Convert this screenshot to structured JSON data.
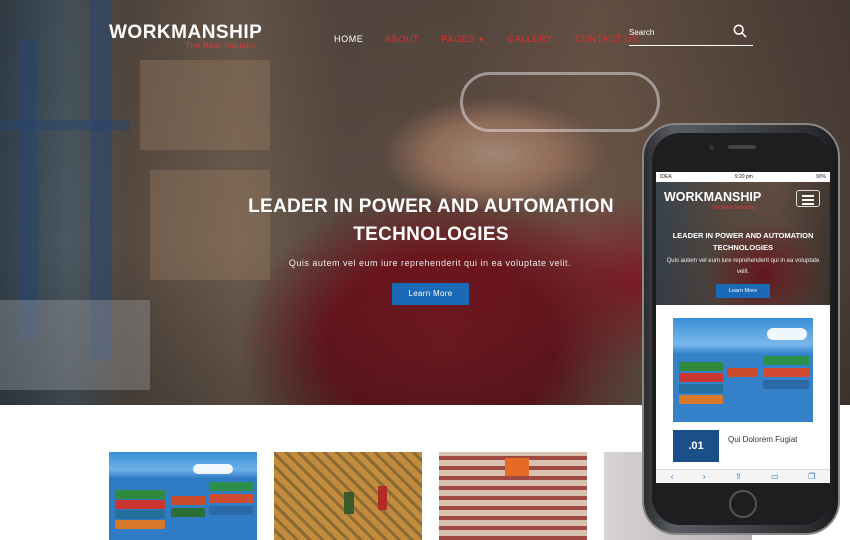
{
  "brand": {
    "name": "WORKMANSHIP",
    "tagline": "The Real Industry"
  },
  "nav": {
    "items": [
      {
        "label": "HOME",
        "active": true
      },
      {
        "label": "ABOUT",
        "active": false
      },
      {
        "label": "PAGES",
        "active": false,
        "has_dropdown": true
      },
      {
        "label": "GALLERY",
        "active": false
      },
      {
        "label": "CONTACT US",
        "active": false
      }
    ]
  },
  "search": {
    "placeholder": "Search",
    "icon": "search-icon"
  },
  "hero": {
    "headline_line1": "LEADER IN POWER AND AUTOMATION",
    "headline_line2": "TECHNOLOGIES",
    "subtext": "Quis autem vel eum iure reprehenderit qui in ea voluptate velit.",
    "button_label": "Learn More"
  },
  "colors": {
    "accent_red": "#e02f2f",
    "button_blue": "#1a6ab8",
    "badge_navy": "#1a4f89"
  },
  "mobile": {
    "status": {
      "carrier": "IDEA",
      "time": "9:20 pm",
      "battery": "90%"
    },
    "brand": {
      "name": "WORKMANSHIP",
      "tagline": "The Real Industry"
    },
    "menu_icon": "hamburger-icon",
    "hero": {
      "headline": "LEADER IN POWER AND AUTOMATION TECHNOLOGIES",
      "subtext": "Quis autem vel eum iure reprehenderit qui in ea voluptate velit.",
      "button_label": "Learn More"
    },
    "card": {
      "number": ".01",
      "caption": "Qui Dolorem Fugiat"
    },
    "toolbar": [
      "back-icon",
      "forward-icon",
      "share-icon",
      "book-icon",
      "tabs-icon"
    ]
  }
}
